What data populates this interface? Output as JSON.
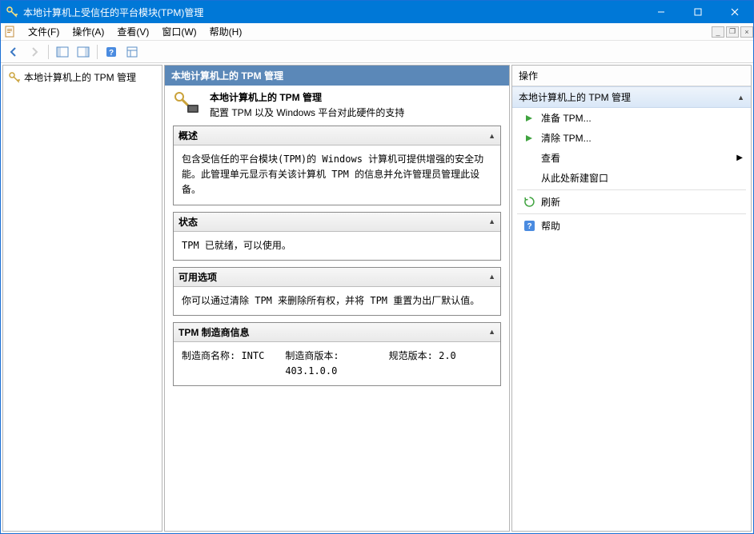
{
  "titlebar": {
    "title": "本地计算机上受信任的平台模块(TPM)管理"
  },
  "menubar": {
    "file": "文件(F)",
    "action": "操作(A)",
    "view": "查看(V)",
    "window": "窗口(W)",
    "help": "帮助(H)"
  },
  "tree": {
    "root": "本地计算机上的 TPM 管理"
  },
  "center": {
    "header": "本地计算机上的 TPM 管理",
    "intro_title": "本地计算机上的 TPM 管理",
    "intro_sub": "配置 TPM 以及 Windows 平台对此硬件的支持",
    "panels": {
      "overview": {
        "title": "概述",
        "body": "包含受信任的平台模块(TPM)的 Windows 计算机可提供增强的安全功能。此管理单元显示有关该计算机 TPM 的信息并允许管理员管理此设备。"
      },
      "status": {
        "title": "状态",
        "body": "TPM 已就绪，可以使用。"
      },
      "options": {
        "title": "可用选项",
        "body": "你可以通过清除 TPM 来删除所有权，并将 TPM 重置为出厂默认值。"
      },
      "mfr": {
        "title": "TPM 制造商信息",
        "name_label": "制造商名称: ",
        "name_value": "INTC",
        "ver_label": "制造商版本: ",
        "ver_value": "403.1.0.0",
        "spec_label": "规范版本: ",
        "spec_value": "2.0"
      }
    }
  },
  "actions": {
    "header": "操作",
    "group_title": "本地计算机上的 TPM 管理",
    "prepare": "准备 TPM...",
    "clear": "清除 TPM...",
    "view": "查看",
    "new_window": "从此处新建窗口",
    "refresh": "刷新",
    "help": "帮助"
  }
}
